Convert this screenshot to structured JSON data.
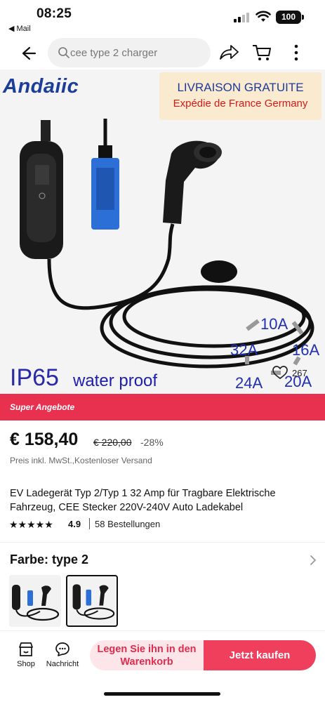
{
  "status_bar": {
    "time": "08:25",
    "back_app": "◀ Mail",
    "battery": "100"
  },
  "nav": {
    "search_placeholder": "cee type 2 charger"
  },
  "hero": {
    "brand": "Andaiic",
    "promo_line1": "LIVRAISON GRATUITE",
    "promo_line2": "Expédie de France Germany",
    "ip_rating": "IP65",
    "waterproof": "water proof",
    "currents": [
      "10A",
      "16A",
      "20A",
      "24A",
      "32A"
    ],
    "likes": "267"
  },
  "deals_banner": "Super Angebote",
  "price": {
    "current": "€ 158,40",
    "original": "€ 220,00",
    "discount": "-28%",
    "note": "Preis inkl. MwSt.,Kostenloser Versand"
  },
  "product": {
    "title": "EV Ladegerät Typ 2/Typ 1 32 Amp für Tragbare Elektrische Fahrzeug, CEE Stecker 220V-240V Auto Ladekabel",
    "stars": 5,
    "rating": "4.9",
    "orders": "58 Bestellungen"
  },
  "color": {
    "label": "Farbe: type 2"
  },
  "bottom_bar": {
    "shop": "Shop",
    "message": "Nachricht",
    "add_to_cart": "Legen Sie ihn in den Warenkorb",
    "buy_now": "Jetzt kaufen"
  },
  "colors": {
    "accent": "#ef3f5c",
    "banner": "#e8304f",
    "brand_blue": "#1b3e9a"
  }
}
